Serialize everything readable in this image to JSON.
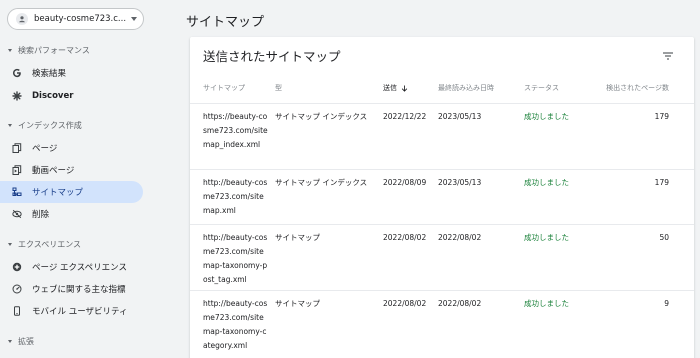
{
  "sidebar": {
    "property": "beauty-cosme723.c...",
    "sections": {
      "performance": "検索パフォーマンス",
      "indexing": "インデックス作成",
      "experience": "エクスペリエンス",
      "enhancements": "拡張"
    },
    "items": {
      "search_results": "検索結果",
      "discover": "Discover",
      "pages": "ページ",
      "video_pages": "動画ページ",
      "sitemaps": "サイトマップ",
      "removals": "削除",
      "page_experience": "ページ エクスペリエンス",
      "web_vitals": "ウェブに関する主な指標",
      "mobile_usability": "モバイル ユーザビリティ"
    }
  },
  "main": {
    "page_title": "サイトマップ",
    "card_title": "送信されたサイトマップ",
    "columns": {
      "sitemap": "サイトマップ",
      "type": "型",
      "submitted": "送信",
      "last_read": "最終読み込み日時",
      "status": "ステータス",
      "discovered": "検出されたページ数"
    },
    "rows": [
      {
        "url": "https://beauty-cosme723.com/sitemap_index.xml",
        "type": "サイトマップ インデックス",
        "submitted": "2022/12/22",
        "last_read": "2023/05/13",
        "status": "成功しました",
        "count": "179"
      },
      {
        "url": "http://beauty-cosme723.com/sitemap.xml",
        "type": "サイトマップ インデックス",
        "submitted": "2022/08/09",
        "last_read": "2023/05/13",
        "status": "成功しました",
        "count": "179"
      },
      {
        "url": "http://beauty-cosme723.com/sitemap-taxonomy-post_tag.xml",
        "type": "サイトマップ",
        "submitted": "2022/08/02",
        "last_read": "2022/08/02",
        "status": "成功しました",
        "count": "50"
      },
      {
        "url": "http://beauty-cosme723.com/sitemap-taxonomy-category.xml",
        "type": "サイトマップ",
        "submitted": "2022/08/02",
        "last_read": "2022/08/02",
        "status": "成功しました",
        "count": "9"
      }
    ]
  },
  "colors": {
    "accent_active_bg": "#d2e3fc",
    "success": "#188038",
    "background": "#f1f3f4"
  },
  "icons": [
    "user-icon",
    "chevron-down-icon",
    "google-g-icon",
    "asterisk-icon",
    "pages-icon",
    "video-pages-icon",
    "sitemap-icon",
    "removals-icon",
    "page-experience-icon",
    "web-vitals-icon",
    "mobile-icon",
    "filter-icon",
    "sort-arrow-down-icon"
  ]
}
